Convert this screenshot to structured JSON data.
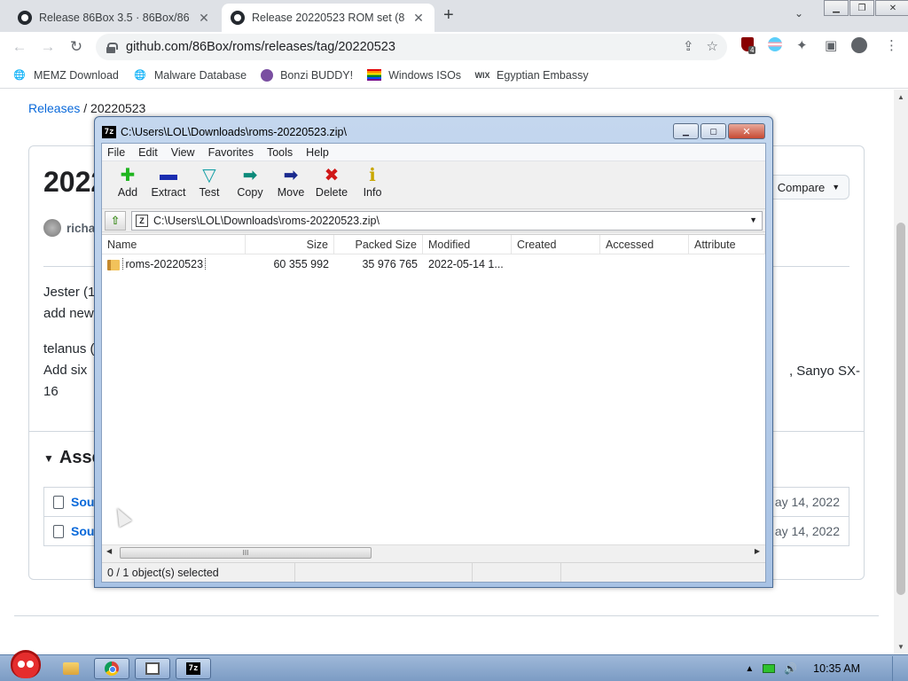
{
  "browser": {
    "tabs": [
      {
        "title": "Release 86Box 3.5 · 86Box/86B",
        "active": false
      },
      {
        "title": "Release 20220523 ROM set (8",
        "active": true
      }
    ],
    "url": "github.com/86Box/roms/releases/tag/20220523",
    "extension_badge": "4",
    "bookmarks": [
      "MEMZ Download",
      "Malware Database",
      "Bonzi BUDDY!",
      "Windows ISOs",
      "Egyptian Embassy"
    ]
  },
  "page": {
    "breadcrumb_link": "Releases",
    "breadcrumb_sep": "/",
    "breadcrumb_current": "20220523",
    "release_title": "2022",
    "author": "richar",
    "compare_label": "Compare",
    "body": {
      "p1_line1": "Jester (1",
      "p1_line2": "add new",
      "p2_line1": "telanus (",
      "p2_line2": "Add six",
      "p2_line3": "16",
      "p2_right": ", Sanyo SX-"
    },
    "assets_label": "Asse",
    "assets": [
      {
        "name": "Sou",
        "date": "ay 14, 2022"
      },
      {
        "name": "Sou",
        "date": "ay 14, 2022"
      }
    ]
  },
  "sevenzip": {
    "title": "C:\\Users\\LOL\\Downloads\\roms-20220523.zip\\",
    "logo": "7z",
    "menu": [
      "File",
      "Edit",
      "View",
      "Favorites",
      "Tools",
      "Help"
    ],
    "toolbar": [
      {
        "label": "Add",
        "glyph": "✚",
        "color": "#1fb51f"
      },
      {
        "label": "Extract",
        "glyph": "▬",
        "color": "#1a2db0"
      },
      {
        "label": "Test",
        "glyph": "▽",
        "color": "#17a0a6"
      },
      {
        "label": "Copy",
        "glyph": "➡",
        "color": "#0b8a7a"
      },
      {
        "label": "Move",
        "glyph": "➡",
        "color": "#1a2a8e"
      },
      {
        "label": "Delete",
        "glyph": "✖",
        "color": "#d01818"
      },
      {
        "label": "Info",
        "glyph": "ℹ",
        "color": "#c9a700"
      }
    ],
    "address": "C:\\Users\\LOL\\Downloads\\roms-20220523.zip\\",
    "columns": [
      "Name",
      "Size",
      "Packed Size",
      "Modified",
      "Created",
      "Accessed",
      "Attribute"
    ],
    "rows": [
      {
        "name": "roms-20220523",
        "size": "60 355 992",
        "packed": "35 976 765",
        "modified": "2022-05-14 1...",
        "created": "",
        "accessed": "",
        "attr": ""
      }
    ],
    "status": "0 / 1 object(s) selected"
  },
  "taskbar": {
    "time": "10:35 AM"
  }
}
